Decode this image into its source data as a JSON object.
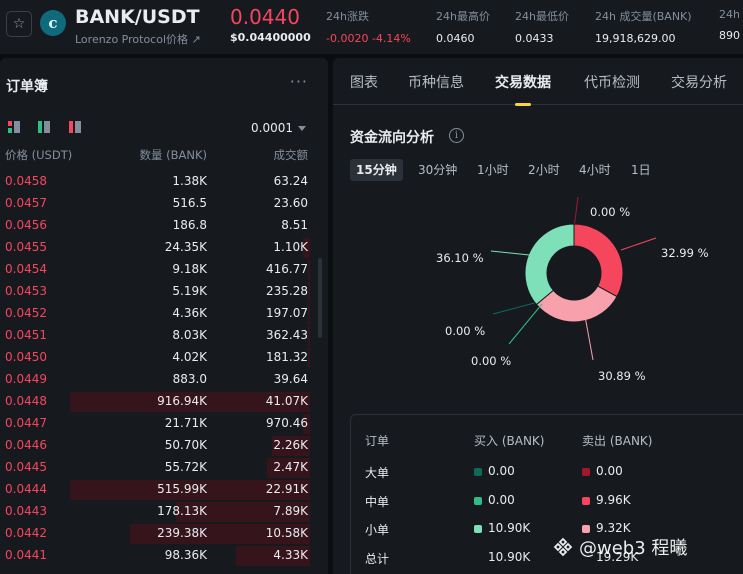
{
  "ticker": {
    "symbol": "BANK/USDT",
    "project": "Lorenzo Protocol价格 ↗",
    "logo_letter": "c",
    "price": "0.0440",
    "price_usd": "$0.04400000",
    "stats": [
      {
        "label": "24h涨跌",
        "value": "-0.0020 -4.14%",
        "negative": true
      },
      {
        "label": "24h最高价",
        "value": "0.0460"
      },
      {
        "label": "24h最低价",
        "value": "0.0433"
      },
      {
        "label": "24h 成交量(BANK)",
        "value": "19,918,629.00"
      },
      {
        "label": "24h",
        "value": "890"
      }
    ]
  },
  "orderbook": {
    "title": "订单簿",
    "more": "···",
    "precision": "0.0001",
    "headers": {
      "price": "价格 (USDT)",
      "qty": "数量 (BANK)",
      "total": "成交额"
    },
    "rows": [
      {
        "price": "0.0458",
        "qty": "1.38K",
        "total": "63.24",
        "depth": 0.0
      },
      {
        "price": "0.0457",
        "qty": "516.5",
        "total": "23.60",
        "depth": 0.0
      },
      {
        "price": "0.0456",
        "qty": "186.8",
        "total": "8.51",
        "depth": 0.0
      },
      {
        "price": "0.0455",
        "qty": "24.35K",
        "total": "1.10K",
        "depth": 0.03
      },
      {
        "price": "0.0454",
        "qty": "9.18K",
        "total": "416.77",
        "depth": 0.01
      },
      {
        "price": "0.0453",
        "qty": "5.19K",
        "total": "235.28",
        "depth": 0.01
      },
      {
        "price": "0.0452",
        "qty": "4.36K",
        "total": "197.07",
        "depth": 0.01
      },
      {
        "price": "0.0451",
        "qty": "8.03K",
        "total": "362.43",
        "depth": 0.01
      },
      {
        "price": "0.0450",
        "qty": "4.02K",
        "total": "181.32",
        "depth": 0.01
      },
      {
        "price": "0.0449",
        "qty": "883.0",
        "total": "39.64",
        "depth": 0.0
      },
      {
        "price": "0.0448",
        "qty": "916.94K",
        "total": "41.07K",
        "depth": 1.0
      },
      {
        "price": "0.0447",
        "qty": "21.71K",
        "total": "970.46",
        "depth": 0.03
      },
      {
        "price": "0.0446",
        "qty": "50.70K",
        "total": "2.26K",
        "depth": 0.16
      },
      {
        "price": "0.0445",
        "qty": "55.72K",
        "total": "2.47K",
        "depth": 0.18
      },
      {
        "price": "0.0444",
        "qty": "515.99K",
        "total": "22.91K",
        "depth": 1.0
      },
      {
        "price": "0.0443",
        "qty": "178.13K",
        "total": "7.89K",
        "depth": 0.56
      },
      {
        "price": "0.0442",
        "qty": "239.38K",
        "total": "10.58K",
        "depth": 0.75
      },
      {
        "price": "0.0441",
        "qty": "98.36K",
        "total": "4.33K",
        "depth": 0.31
      }
    ]
  },
  "tabs": [
    "图表",
    "币种信息",
    "交易数据",
    "代币检测",
    "交易分析"
  ],
  "active_tab": "交易数据",
  "capital_flow": {
    "title": "资金流向分析",
    "timeframes": [
      "15分钟",
      "30分钟",
      "1小时",
      "2小时",
      "4小时",
      "1日"
    ],
    "active_timeframe": "15分钟"
  },
  "colors": {
    "buy_large": "#0e6b57",
    "buy_medium": "#2ebd85",
    "buy_small": "#7ee0b8",
    "sell_large": "#a3172c",
    "sell_medium": "#f6465d",
    "sell_small": "#f8a1ad"
  },
  "chart_data": {
    "type": "pie",
    "series": [
      {
        "value": 0.0,
        "label": "0.00 %",
        "color_key": "sell_large"
      },
      {
        "value": 32.99,
        "label": "32.99 %",
        "color_key": "sell_medium"
      },
      {
        "value": 30.89,
        "label": "30.89 %",
        "color_key": "sell_small"
      },
      {
        "value": 0.0,
        "label": "0.00 %",
        "color_key": "buy_large"
      },
      {
        "value": 0.0,
        "label": "0.00 %",
        "color_key": "buy_medium"
      },
      {
        "value": 36.1,
        "label": "36.10 %",
        "color_key": "buy_small"
      }
    ]
  },
  "flow_table": {
    "headers": {
      "order": "订单",
      "buy": "买入 (BANK)",
      "sell": "卖出 (BANK)"
    },
    "rows": [
      {
        "label": "大单",
        "buy": "0.00",
        "sell": "0.00",
        "buy_color": "#0e6b57",
        "sell_color": "#a3172c"
      },
      {
        "label": "中单",
        "buy": "0.00",
        "sell": "9.96K",
        "buy_color": "#2ebd85",
        "sell_color": "#f6465d"
      },
      {
        "label": "小单",
        "buy": "10.90K",
        "sell": "9.32K",
        "buy_color": "#7ee0b8",
        "sell_color": "#f8a1ad"
      },
      {
        "label": "总计",
        "buy": "10.90K",
        "sell": "19.29K"
      }
    ]
  },
  "watermark": "@web3 程曦"
}
